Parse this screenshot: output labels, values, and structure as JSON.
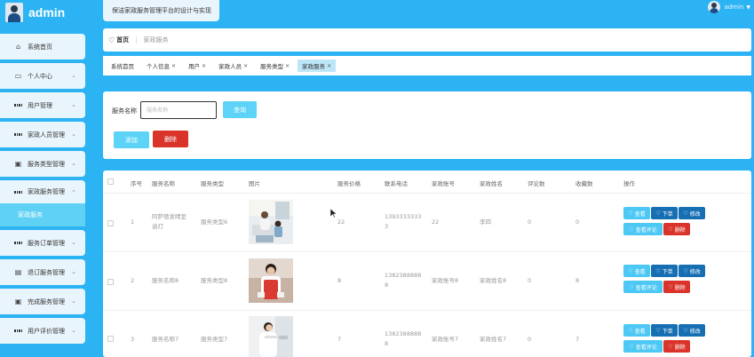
{
  "brand": {
    "title": "admin"
  },
  "sidebar": {
    "items": [
      {
        "label": "系统首页",
        "icon": "home-icon"
      },
      {
        "label": "个人中心",
        "icon": "user-card-icon"
      },
      {
        "label": "用户管理",
        "icon": "grid-icon"
      },
      {
        "label": "家政人员管理",
        "icon": "grid-icon"
      },
      {
        "label": "服务类型管理",
        "icon": "monitor-icon"
      },
      {
        "label": "家政服务管理",
        "icon": "grid-icon",
        "sub": "家政服务"
      },
      {
        "label": "服务订单管理",
        "icon": "grid-icon"
      },
      {
        "label": "退订服务管理",
        "icon": "clipboard-icon"
      },
      {
        "label": "完成服务管理",
        "icon": "monitor-icon"
      },
      {
        "label": "用户评价管理",
        "icon": "grid-icon"
      }
    ]
  },
  "header": {
    "system_title": "保洁家政服务管理平台的设计与实现",
    "user_name": "admin"
  },
  "breadcrumb": {
    "home": "首页",
    "current": "家政服务"
  },
  "tags": [
    "系统首页",
    "个人信息",
    "用户",
    "家政人员",
    "服务类型",
    "家政服务"
  ],
  "search": {
    "label": "服务名称",
    "placeholder": "服务名称",
    "query_button": "查询",
    "add_button": "添加",
    "delete_button": "删除"
  },
  "table": {
    "headers": [
      "序号",
      "服务名称",
      "服务类型",
      "图片",
      "服务价格",
      "联系电话",
      "家政账号",
      "家政姓名",
      "评论数",
      "收藏数",
      "操作"
    ],
    "rows": [
      {
        "index": "1",
        "name_line1": "阿萨德发晴室",
        "name_line2": "迪灯",
        "type": "服务类型6",
        "price": "22",
        "phone_line1": "1393333333",
        "phone_line2": "3",
        "account": "22",
        "staff": "李四",
        "comments": "0",
        "favorites": "0"
      },
      {
        "index": "2",
        "name_line1": "服务名称8",
        "name_line2": "",
        "type": "服务类型8",
        "price": "8",
        "phone_line1": "1382388888",
        "phone_line2": "8",
        "account": "家政账号8",
        "staff": "家政姓名8",
        "comments": "0",
        "favorites": "8"
      },
      {
        "index": "3",
        "name_line1": "服务名称7",
        "name_line2": "",
        "type": "服务类型7",
        "price": "7",
        "phone_line1": "1382388888",
        "phone_line2": "8",
        "account": "家政账号7",
        "staff": "家政姓名7",
        "comments": "0",
        "favorites": "7"
      }
    ],
    "actions": {
      "view": "查看",
      "order": "下单",
      "edit": "修改",
      "review": "查看评论",
      "delete": "删除"
    }
  },
  "colors": {
    "sidebar_bg": "#2bb3f3",
    "accent": "#5dd3f7",
    "danger": "#d9332a",
    "primary_dark": "#176fb3"
  }
}
